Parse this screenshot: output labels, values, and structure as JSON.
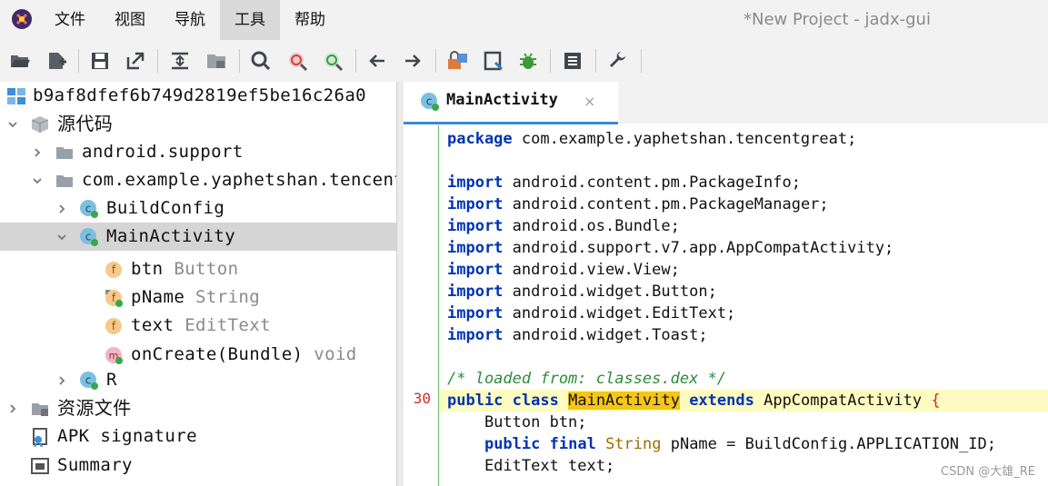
{
  "window": {
    "title": "*New Project - jadx-gui"
  },
  "menu": {
    "items": [
      "文件",
      "视图",
      "导航",
      "工具",
      "帮助"
    ],
    "active_index": 3
  },
  "toolbar": {
    "icons": [
      "open-folder-icon",
      "add-file-icon",
      "save-icon",
      "export-icon",
      "sync-icon",
      "flatten-packages-icon",
      "search-icon",
      "find-class-icon",
      "find-usage-icon",
      "back-icon",
      "forward-icon",
      "deobfuscation-icon",
      "quick-tab-icon",
      "debug-icon",
      "log-icon",
      "preferences-icon"
    ]
  },
  "tree": {
    "root": "b9af8dfef6b749d2819ef5be16c26a0",
    "source_code": "源代码",
    "pkg_support": "android.support",
    "pkg_main": "com.example.yaphetshan.tencentgreat",
    "class_buildconfig": "BuildConfig",
    "class_main": "MainActivity",
    "field_btn": "btn",
    "field_btn_type": "Button",
    "field_pname": "pName",
    "field_pname_type": "String",
    "field_text": "text",
    "field_text_type": "EditText",
    "method_oncreate": "onCreate(Bundle)",
    "method_oncreate_type": "void",
    "class_r": "R",
    "resources": "资源文件",
    "apk_signature": "APK signature",
    "summary": "Summary"
  },
  "editor": {
    "tab_label": "MainActivity",
    "tab_close": "×",
    "highlight_line_number": "30",
    "code": {
      "kw_package": "package",
      "package_name": " com.example.yaphetshan.tencentgreat;",
      "kw_import": "import",
      "imports": [
        " android.content.pm.PackageInfo;",
        " android.content.pm.PackageManager;",
        " android.os.Bundle;",
        " android.support.v7.app.AppCompatActivity;",
        " android.view.View;",
        " android.widget.Button;",
        " android.widget.EditText;",
        " android.widget.Toast;"
      ],
      "comment": "/* loaded from: classes.dex */",
      "kw_public": "public",
      "kw_class": "class",
      "class_name": "MainActivity",
      "kw_extends": "extends",
      "super_class": "AppCompatActivity",
      "open_brace": "{",
      "line_btn": "    Button btn;",
      "kw_final": "final",
      "type_string": "String",
      "pname_rest": " pName = BuildConfig.APPLICATION_ID;",
      "line_text": "    EditText text;"
    }
  },
  "watermark": "CSDN @大雄_RE"
}
